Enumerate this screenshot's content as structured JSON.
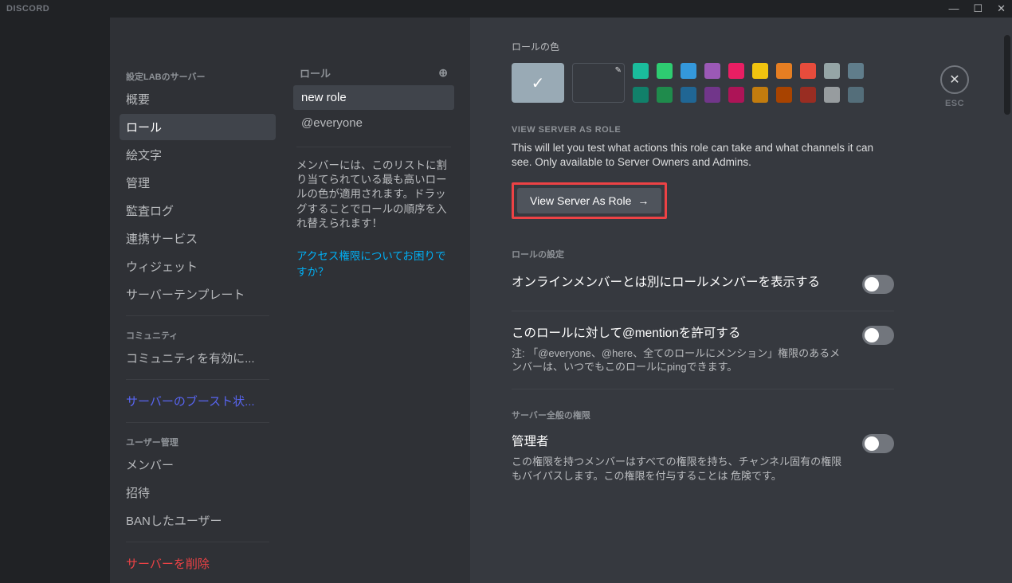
{
  "titlebar": {
    "logo": "DISCORD",
    "minimize": "—",
    "maximize": "☐",
    "close": "✕"
  },
  "nav": {
    "server_header": "設定LABのサーバー",
    "items": [
      "概要",
      "ロール",
      "絵文字",
      "管理",
      "監査ログ",
      "連携サービス",
      "ウィジェット",
      "サーバーテンプレート"
    ],
    "community_header": "コミュニティ",
    "community_item": "コミュニティを有効に...",
    "boost_item": "サーバーのブースト状...",
    "user_header": "ユーザー管理",
    "user_items": [
      "メンバー",
      "招待",
      "BANしたユーザー"
    ],
    "delete": "サーバーを削除"
  },
  "roles": {
    "header": "ロール",
    "list": [
      "new role",
      "@everyone"
    ],
    "help": "メンバーには、このリストに割り当てられている最も高いロールの色が適用されます。ドラッグすることでロールの順序を入れ替えられます！",
    "link": "アクセス権限についてお困りですか？"
  },
  "content": {
    "color_label": "ロールの色",
    "colors_row1": [
      "#1abc9c",
      "#2ecc71",
      "#3498db",
      "#9b59b6",
      "#e91e63",
      "#f1c40f",
      "#e67e22",
      "#e74c3c",
      "#95a5a6",
      "#607d8b"
    ],
    "colors_row2": [
      "#11806a",
      "#1f8b4c",
      "#206694",
      "#71368a",
      "#ad1457",
      "#c27c0e",
      "#a84300",
      "#992d22",
      "#979c9f",
      "#546e7a"
    ],
    "view_header": "VIEW SERVER AS ROLE",
    "view_desc": "This will let you test what actions this role can take and what channels it can see. Only available to Server Owners and Admins.",
    "view_button": "View Server As Role",
    "settings_header": "ロールの設定",
    "toggle1_title": "オンラインメンバーとは別にロールメンバーを表示する",
    "toggle2_title": "このロールに対して@mentionを許可する",
    "toggle2_note": "注: 「@everyone、@here、全てのロールにメンション」権限のあるメンバーは、いつでもこのロールにpingできます。",
    "perm_header": "サーバー全般の権限",
    "perm1_title": "管理者",
    "perm1_note": "この権限を持つメンバーはすべての権限を持ち、チャンネル固有の権限もバイパスします。この権限を付与することは 危険です。"
  },
  "close": {
    "label": "ESC"
  }
}
